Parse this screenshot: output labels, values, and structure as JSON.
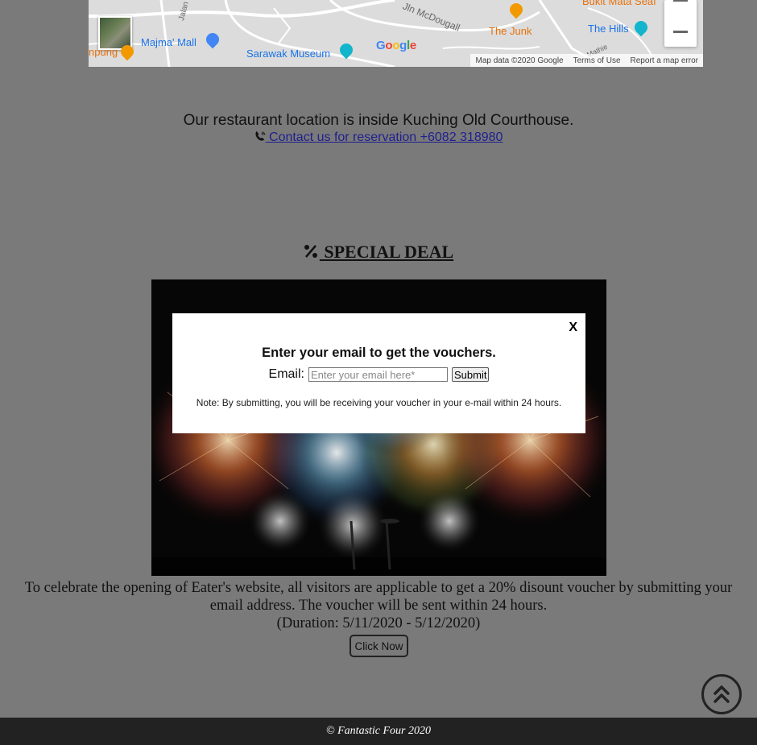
{
  "map": {
    "places": [
      {
        "name": "Majma' Mall",
        "color": "blue"
      },
      {
        "name": "Sarawak Museum",
        "color": "teal"
      },
      {
        "name": "The Junk",
        "color": "orange"
      },
      {
        "name": "The Hills",
        "color": "teal"
      },
      {
        "name": "Bukit Mata Seaf",
        "color": "orange"
      },
      {
        "name": "npung",
        "color": "orange"
      }
    ],
    "streets": [
      "Jalan Haji",
      "Jln McDougall",
      "Mathie"
    ],
    "footer": {
      "map_data": "Map data ©2020 Google",
      "terms": "Terms of Use",
      "report": "Report a map error"
    },
    "logo_letters": [
      "G",
      "o",
      "o",
      "g",
      "l",
      "e"
    ]
  },
  "location": {
    "text": "Our restaurant location is inside Kuching Old Courthouse.",
    "contact_link": " Contact us for reservation +6082 318980"
  },
  "deal": {
    "heading": " SPECIAL DEAL",
    "description": "To celebrate the opening of Eater's website, all visitors are applicable to get a 20% disount voucher by submitting your email address. The voucher will be sent within 24 hours.",
    "duration": "(Duration: 5/11/2020 - 5/12/2020)",
    "cta_label": "Click Now"
  },
  "modal": {
    "close_label": "X",
    "title": "Enter your email to get the vouchers.",
    "email_label": "Email:",
    "email_placeholder": "Enter your email here*",
    "email_value": "",
    "submit_label": "Submit",
    "note": "Note: By submitting, you will be receiving your voucher in your e-mail within 24 hours."
  },
  "footer": {
    "copyright": "© Fantastic Four 2020"
  },
  "colors": {
    "overlay_bg": "#7a7a7a",
    "footer_bg": "#222222",
    "link": "#1f1f8f"
  }
}
